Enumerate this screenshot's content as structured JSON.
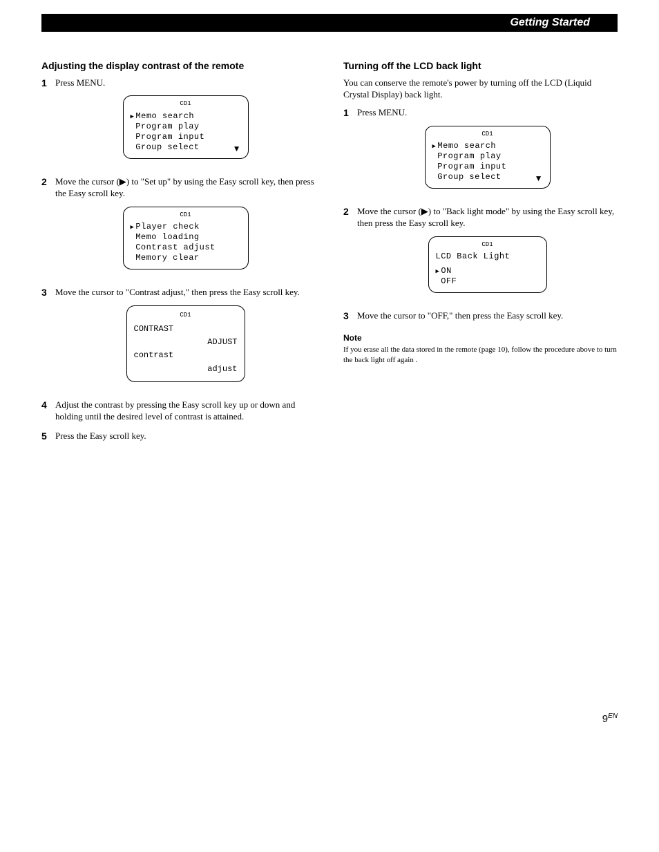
{
  "header": {
    "section_label": "Getting Started"
  },
  "left": {
    "title": "Adjusting the display contrast of the remote",
    "steps": {
      "s1": {
        "num": "1",
        "text": "Press MENU."
      },
      "s2": {
        "num": "2",
        "text": "Move the cursor (▶) to \"Set up\" by using the Easy scroll key, then press the Easy scroll key."
      },
      "s3": {
        "num": "3",
        "text": "Move the cursor to \"Contrast adjust,\" then press the Easy scroll key."
      },
      "s4": {
        "num": "4",
        "text": "Adjust the contrast by pressing the Easy scroll key up or down and holding until the desired level of contrast is attained."
      },
      "s5": {
        "num": "5",
        "text": "Press the Easy scroll key."
      }
    },
    "lcd1": {
      "header": "CD1",
      "l1": "Memo search",
      "l2": "Program play",
      "l3": "Program input",
      "l4": "Group select"
    },
    "lcd2": {
      "header": "CD1",
      "l1": "Player check",
      "l2": "Memo loading",
      "l3": "Contrast adjust",
      "l4": "Memory clear"
    },
    "lcd3": {
      "header": "CD1",
      "r1a": "CONTRAST",
      "r1b": "ADJUST",
      "r2a": "contrast",
      "r2b": "adjust"
    }
  },
  "right": {
    "title": "Turning off the LCD back light",
    "intro": "You can conserve the remote's power by turning off the LCD (Liquid Crystal Display) back light.",
    "steps": {
      "s1": {
        "num": "1",
        "text": "Press MENU."
      },
      "s2": {
        "num": "2",
        "text": "Move the cursor (▶) to \"Back light mode\" by using the Easy scroll key, then press the Easy scroll key."
      },
      "s3": {
        "num": "3",
        "text": "Move the cursor to \"OFF,\" then press the Easy scroll key."
      }
    },
    "lcd1": {
      "header": "CD1",
      "l1": "Memo search",
      "l2": "Program play",
      "l3": "Program input",
      "l4": "Group select"
    },
    "lcd2": {
      "header": "CD1",
      "title_line": "LCD Back Light",
      "l1": "ON",
      "l2": "OFF"
    },
    "note": {
      "label": "Note",
      "body": "If you erase all the data stored in the remote (page 10), follow the procedure above to turn the back light off again ."
    }
  },
  "page_number": {
    "num": "9",
    "suffix": "EN"
  }
}
